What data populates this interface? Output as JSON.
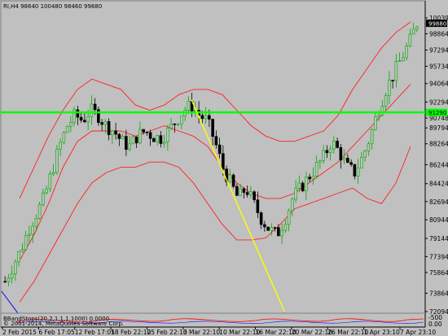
{
  "window": {
    "symbol_info": "RI,H4  98640 100480 98460 99880"
  },
  "indicator": {
    "label": "BBandStops(20,2,1,1,1,1000) 0.0000",
    "zero_label": "0.00",
    "top_label": "-500"
  },
  "watermark": "© 2001-2014, MetaQuotes Software Corp.",
  "colors": {
    "background": "#c0c0c0",
    "bull": "#00aa00",
    "bear": "#000000",
    "band": "#ff2020",
    "level_line": "#00ff00",
    "trend_line": "#ffff00",
    "current_price_bg": "#000000",
    "level_badge_bg": "#00ff00"
  },
  "chart_data": {
    "type": "candlestick",
    "y_ticks": [
      100394,
      98864,
      97294,
      95734,
      94064,
      92294,
      90748,
      89794,
      88264,
      86244,
      84424,
      82694,
      80944,
      79144,
      77394,
      75864,
      73864,
      72094
    ],
    "x_ticks": [
      "2 Feb 2015",
      "6 Feb 17:05",
      "12 Feb 17:05",
      "18 Feb 22:10",
      "25 Feb 22:10",
      "3 Mar 22:10",
      "10 Mar 22:10",
      "16 Mar 22:10",
      "20 Mar 22:10",
      "26 Mar 22:10",
      "1 Apr 23:10",
      "7 Apr 23:10"
    ],
    "current_price": "99880",
    "level_line_value": "91290",
    "level_line_price": 91290,
    "ylim": [
      72094,
      100394
    ],
    "closes": [
      75000,
      76500,
      78000,
      80000,
      81500,
      83000,
      85500,
      88000,
      90000,
      91000,
      90500,
      91500,
      91000,
      90000,
      89500,
      88500,
      88000,
      89000,
      89500,
      89000,
      88800,
      89500,
      90500,
      91500,
      92000,
      91000,
      90500,
      88500,
      86000,
      84500,
      83000,
      84000,
      82500,
      81000,
      80000,
      79500,
      81000,
      83000,
      84000,
      85000,
      86000,
      87000,
      88500,
      87500,
      86000,
      85500,
      87000,
      89000,
      91500,
      93500,
      95000,
      96500,
      98000,
      99880
    ],
    "upper_band": [
      83000,
      86000,
      89000,
      91500,
      93500,
      94500,
      94000,
      93500,
      92000,
      91500,
      92000,
      93000,
      93500,
      93500,
      93000,
      91500,
      90000,
      89000,
      88500,
      88500,
      89000,
      89500,
      91000,
      93500,
      95500,
      97500,
      99000,
      100000
    ],
    "middle_band": [
      77000,
      79500,
      82500,
      86000,
      88500,
      89500,
      89500,
      89500,
      89000,
      89500,
      90000,
      89500,
      89000,
      88000,
      86000,
      84500,
      83500,
      83000,
      83000,
      83500,
      84500,
      85500,
      86500,
      88000,
      89500,
      91000,
      92500,
      94000
    ],
    "lower_band": [
      73000,
      75000,
      77500,
      80000,
      82500,
      84500,
      85500,
      86000,
      86000,
      86500,
      86500,
      86000,
      84500,
      82500,
      80500,
      79000,
      79000,
      79200,
      80500,
      82000,
      82500,
      83000,
      83500,
      84000,
      83000,
      82500,
      84500,
      88000
    ],
    "trend_line": [
      [
        92500,
        0.453
      ],
      [
        72094,
        0.677
      ]
    ]
  }
}
